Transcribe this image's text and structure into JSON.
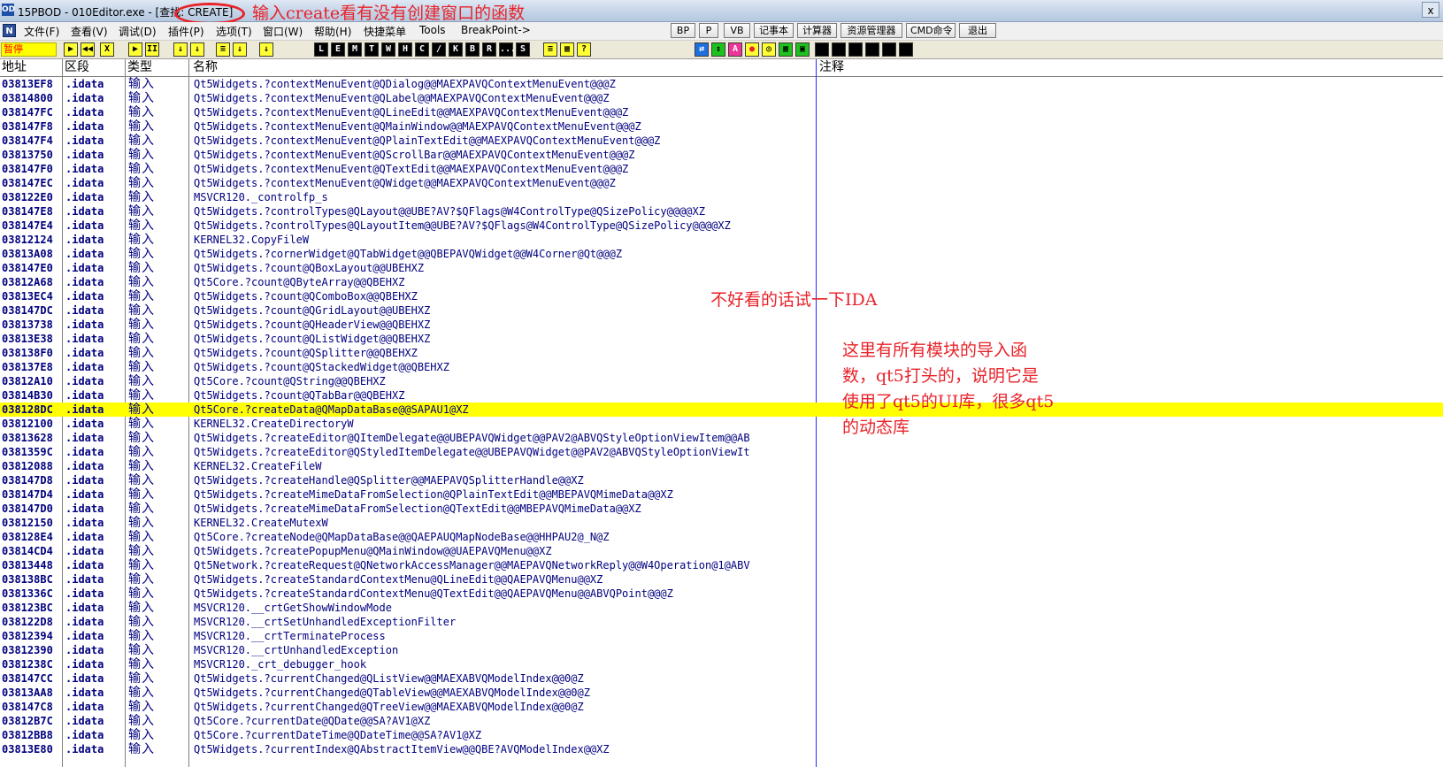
{
  "window": {
    "title": "15PBOD - 010Editor.exe - [查找: CREATE]",
    "close": "x"
  },
  "annotations": {
    "title_note": "输入create看有没有创建窗口的函数",
    "ida_note": "不好看的话试一下IDA",
    "modules_note": "这里有所有模块的导入函数，qt5打头的，说明它是使用了qt5的UI库，很多qt5的动态库"
  },
  "menu": {
    "logo": "N",
    "items": [
      "文件(F)",
      "查看(V)",
      "调试(D)",
      "插件(P)",
      "选项(T)",
      "窗口(W)",
      "帮助(H)",
      "快捷菜单",
      "Tools",
      "BreakPoint->"
    ],
    "buttons": [
      "BP",
      "P",
      "VB",
      "记事本",
      "计算器",
      "资源管理器",
      "CMD命令",
      "退出"
    ]
  },
  "toolbar": {
    "status": "暂停",
    "buttons": [
      "▶",
      "◀◀",
      "X",
      "▶",
      "II",
      "↓",
      "↓",
      "≡",
      "↓",
      "↓",
      "L",
      "E",
      "M",
      "T",
      "W",
      "H",
      "C",
      "/",
      "K",
      "B",
      "R",
      "...",
      "S",
      "≡",
      "▦",
      "?"
    ],
    "right_buttons": [
      "⇄",
      "↕",
      "A",
      "●",
      "◎",
      "▦",
      "▣"
    ]
  },
  "columns": {
    "address": "地址",
    "section": "区段",
    "type": "类型",
    "name": "名称",
    "comment": "注释"
  },
  "rows": [
    {
      "addr": "03813EF8",
      "sec": ".idata",
      "type": "输入",
      "name": "Qt5Widgets.?contextMenuEvent@QDialog@@MAEXPAVQContextMenuEvent@@@Z"
    },
    {
      "addr": "03814800",
      "sec": ".idata",
      "type": "输入",
      "name": "Qt5Widgets.?contextMenuEvent@QLabel@@MAEXPAVQContextMenuEvent@@@Z"
    },
    {
      "addr": "038147FC",
      "sec": ".idata",
      "type": "输入",
      "name": "Qt5Widgets.?contextMenuEvent@QLineEdit@@MAEXPAVQContextMenuEvent@@@Z"
    },
    {
      "addr": "038147F8",
      "sec": ".idata",
      "type": "输入",
      "name": "Qt5Widgets.?contextMenuEvent@QMainWindow@@MAEXPAVQContextMenuEvent@@@Z"
    },
    {
      "addr": "038147F4",
      "sec": ".idata",
      "type": "输入",
      "name": "Qt5Widgets.?contextMenuEvent@QPlainTextEdit@@MAEXPAVQContextMenuEvent@@@Z"
    },
    {
      "addr": "03813750",
      "sec": ".idata",
      "type": "输入",
      "name": "Qt5Widgets.?contextMenuEvent@QScrollBar@@MAEXPAVQContextMenuEvent@@@Z"
    },
    {
      "addr": "038147F0",
      "sec": ".idata",
      "type": "输入",
      "name": "Qt5Widgets.?contextMenuEvent@QTextEdit@@MAEXPAVQContextMenuEvent@@@Z"
    },
    {
      "addr": "038147EC",
      "sec": ".idata",
      "type": "输入",
      "name": "Qt5Widgets.?contextMenuEvent@QWidget@@MAEXPAVQContextMenuEvent@@@Z"
    },
    {
      "addr": "038122E0",
      "sec": ".idata",
      "type": "输入",
      "name": "MSVCR120._controlfp_s"
    },
    {
      "addr": "038147E8",
      "sec": ".idata",
      "type": "输入",
      "name": "Qt5Widgets.?controlTypes@QLayout@@UBE?AV?$QFlags@W4ControlType@QSizePolicy@@@@XZ"
    },
    {
      "addr": "038147E4",
      "sec": ".idata",
      "type": "输入",
      "name": "Qt5Widgets.?controlTypes@QLayoutItem@@UBE?AV?$QFlags@W4ControlType@QSizePolicy@@@@XZ"
    },
    {
      "addr": "03812124",
      "sec": ".idata",
      "type": "输入",
      "name": "KERNEL32.CopyFileW"
    },
    {
      "addr": "03813A08",
      "sec": ".idata",
      "type": "输入",
      "name": "Qt5Widgets.?cornerWidget@QTabWidget@@QBEPAVQWidget@@W4Corner@Qt@@@Z"
    },
    {
      "addr": "038147E0",
      "sec": ".idata",
      "type": "输入",
      "name": "Qt5Widgets.?count@QBoxLayout@@UBEHXZ"
    },
    {
      "addr": "03812A68",
      "sec": ".idata",
      "type": "输入",
      "name": "Qt5Core.?count@QByteArray@@QBEHXZ"
    },
    {
      "addr": "03813EC4",
      "sec": ".idata",
      "type": "输入",
      "name": "Qt5Widgets.?count@QComboBox@@QBEHXZ"
    },
    {
      "addr": "038147DC",
      "sec": ".idata",
      "type": "输入",
      "name": "Qt5Widgets.?count@QGridLayout@@UBEHXZ"
    },
    {
      "addr": "03813738",
      "sec": ".idata",
      "type": "输入",
      "name": "Qt5Widgets.?count@QHeaderView@@QBEHXZ"
    },
    {
      "addr": "03813E38",
      "sec": ".idata",
      "type": "输入",
      "name": "Qt5Widgets.?count@QListWidget@@QBEHXZ"
    },
    {
      "addr": "038138F0",
      "sec": ".idata",
      "type": "输入",
      "name": "Qt5Widgets.?count@QSplitter@@QBEHXZ"
    },
    {
      "addr": "038137E8",
      "sec": ".idata",
      "type": "输入",
      "name": "Qt5Widgets.?count@QStackedWidget@@QBEHXZ"
    },
    {
      "addr": "03812A10",
      "sec": ".idata",
      "type": "输入",
      "name": "Qt5Core.?count@QString@@QBEHXZ"
    },
    {
      "addr": "03814B30",
      "sec": ".idata",
      "type": "输入",
      "name": "Qt5Widgets.?count@QTabBar@@QBEHXZ"
    },
    {
      "addr": "038128DC",
      "sec": ".idata",
      "type": "输入",
      "name": "Qt5Core.?createData@QMapDataBase@@SAPAU1@XZ",
      "selected": true
    },
    {
      "addr": "03812100",
      "sec": ".idata",
      "type": "输入",
      "name": "KERNEL32.CreateDirectoryW"
    },
    {
      "addr": "03813628",
      "sec": ".idata",
      "type": "输入",
      "name": "Qt5Widgets.?createEditor@QItemDelegate@@UBEPAVQWidget@@PAV2@ABVQStyleOptionViewItem@@AB"
    },
    {
      "addr": "0381359C",
      "sec": ".idata",
      "type": "输入",
      "name": "Qt5Widgets.?createEditor@QStyledItemDelegate@@UBEPAVQWidget@@PAV2@ABVQStyleOptionViewIt"
    },
    {
      "addr": "03812088",
      "sec": ".idata",
      "type": "输入",
      "name": "KERNEL32.CreateFileW"
    },
    {
      "addr": "038147D8",
      "sec": ".idata",
      "type": "输入",
      "name": "Qt5Widgets.?createHandle@QSplitter@@MAEPAVQSplitterHandle@@XZ"
    },
    {
      "addr": "038147D4",
      "sec": ".idata",
      "type": "输入",
      "name": "Qt5Widgets.?createMimeDataFromSelection@QPlainTextEdit@@MBEPAVQMimeData@@XZ"
    },
    {
      "addr": "038147D0",
      "sec": ".idata",
      "type": "输入",
      "name": "Qt5Widgets.?createMimeDataFromSelection@QTextEdit@@MBEPAVQMimeData@@XZ"
    },
    {
      "addr": "03812150",
      "sec": ".idata",
      "type": "输入",
      "name": "KERNEL32.CreateMutexW"
    },
    {
      "addr": "038128E4",
      "sec": ".idata",
      "type": "输入",
      "name": "Qt5Core.?createNode@QMapDataBase@@QAEPAUQMapNodeBase@@HHPAU2@_N@Z"
    },
    {
      "addr": "03814CD4",
      "sec": ".idata",
      "type": "输入",
      "name": "Qt5Widgets.?createPopupMenu@QMainWindow@@UAEPAVQMenu@@XZ"
    },
    {
      "addr": "03813448",
      "sec": ".idata",
      "type": "输入",
      "name": "Qt5Network.?createRequest@QNetworkAccessManager@@MAEPAVQNetworkReply@@W4Operation@1@ABV"
    },
    {
      "addr": "038138BC",
      "sec": ".idata",
      "type": "输入",
      "name": "Qt5Widgets.?createStandardContextMenu@QLineEdit@@QAEPAVQMenu@@XZ"
    },
    {
      "addr": "0381336C",
      "sec": ".idata",
      "type": "输入",
      "name": "Qt5Widgets.?createStandardContextMenu@QTextEdit@@QAEPAVQMenu@@ABVQPoint@@@Z"
    },
    {
      "addr": "038123BC",
      "sec": ".idata",
      "type": "输入",
      "name": "MSVCR120.__crtGetShowWindowMode"
    },
    {
      "addr": "038122D8",
      "sec": ".idata",
      "type": "输入",
      "name": "MSVCR120.__crtSetUnhandledExceptionFilter"
    },
    {
      "addr": "03812394",
      "sec": ".idata",
      "type": "输入",
      "name": "MSVCR120.__crtTerminateProcess"
    },
    {
      "addr": "03812390",
      "sec": ".idata",
      "type": "输入",
      "name": "MSVCR120.__crtUnhandledException"
    },
    {
      "addr": "0381238C",
      "sec": ".idata",
      "type": "输入",
      "name": "MSVCR120._crt_debugger_hook"
    },
    {
      "addr": "038147CC",
      "sec": ".idata",
      "type": "输入",
      "name": "Qt5Widgets.?currentChanged@QListView@@MAEXABVQModelIndex@@0@Z"
    },
    {
      "addr": "03813AA8",
      "sec": ".idata",
      "type": "输入",
      "name": "Qt5Widgets.?currentChanged@QTableView@@MAEXABVQModelIndex@@0@Z"
    },
    {
      "addr": "038147C8",
      "sec": ".idata",
      "type": "输入",
      "name": "Qt5Widgets.?currentChanged@QTreeView@@MAEXABVQModelIndex@@0@Z"
    },
    {
      "addr": "03812B7C",
      "sec": ".idata",
      "type": "输入",
      "name": "Qt5Core.?currentDate@QDate@@SA?AV1@XZ"
    },
    {
      "addr": "03812BB8",
      "sec": ".idata",
      "type": "输入",
      "name": "Qt5Core.?currentDateTime@QDateTime@@SA?AV1@XZ"
    },
    {
      "addr": "03813E80",
      "sec": ".idata",
      "type": "输入",
      "name": "Qt5Widgets.?currentIndex@QAbstractItemView@@QBE?AVQModelIndex@@XZ"
    }
  ]
}
